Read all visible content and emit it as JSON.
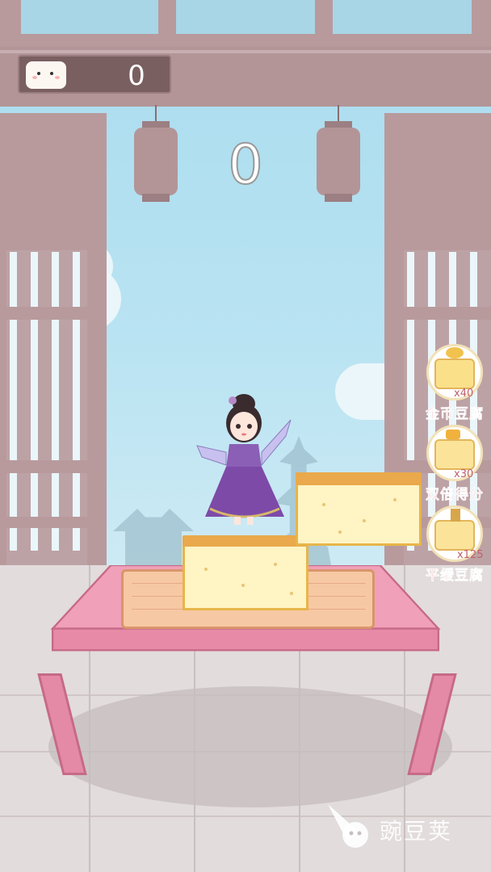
{
  "hud": {
    "coin_count": "0",
    "stack_score": "0",
    "coin_icon": "tofu-icon"
  },
  "power_ups": [
    {
      "label": "金币豆腐",
      "count": "x40",
      "icon": "gold-tofu-icon"
    },
    {
      "label": "双倍得分",
      "count": "x30",
      "icon": "double-score-tofu-icon"
    },
    {
      "label": "平缓豆腐",
      "count": "x125",
      "icon": "gentle-tofu-icon"
    }
  ],
  "watermark": {
    "text": "豌豆荚"
  },
  "colors": {
    "sky": "#a9dcee",
    "frame": "#b89a9d",
    "table": "#f0a0b8",
    "tofu": "#fff4c4",
    "tofu_crust": "#e9a94c",
    "label_red": "#d34a4a"
  }
}
